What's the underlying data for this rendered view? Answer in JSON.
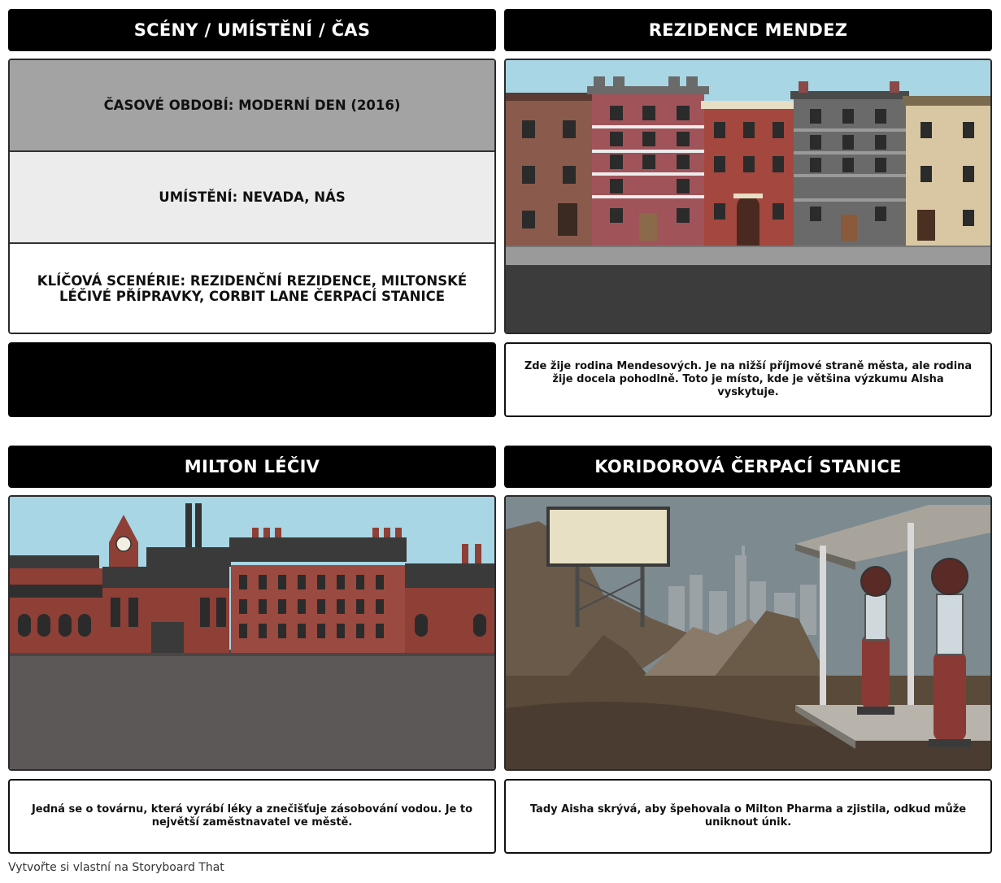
{
  "panels": [
    {
      "title": "SCÉNY / UMÍSTĚNÍ / ČAS",
      "rows": [
        "ČASOVÉ OBDOBÍ: MODERNÍ DEN (2016)",
        "UMÍSTĚNÍ: NEVADA, NÁS",
        "KLÍČOVÁ SCENÉRIE: REZIDENČNÍ REZIDENCE, MILTONSKÉ LÉČIVÉ PŘÍPRAVKY, CORBIT LANE ČERPACÍ STANICE"
      ],
      "caption": ""
    },
    {
      "title": "REZIDENCE MENDEZ",
      "caption": "Zde žije rodina Mendesových. Je na nižší příjmové straně města, ale rodina žije docela pohodlně. Toto je místo, kde je většina výzkumu Alsha vyskytuje."
    },
    {
      "title": "MILTON LÉČIV",
      "caption": "Jedná se o továrnu, která vyrábí léky a znečišťuje zásobování vodou. Je to největší zaměstnavatel ve městě."
    },
    {
      "title": "KORIDOROVÁ ČERPACÍ STANICE",
      "caption": "Tady Aisha skrývá, aby špehovala o Milton Pharma a zjistila, odkud může uniknout únik."
    }
  ],
  "footer": "Vytvořte si vlastní na Storyboard That",
  "colors": {
    "header_bg": "#000000",
    "header_text": "#ffffff",
    "row1_bg": "#a3a3a3",
    "row2_bg": "#ececec",
    "row3_bg": "#ffffff",
    "sky": "#a9d6e5",
    "brick": "#8e4a3e"
  }
}
